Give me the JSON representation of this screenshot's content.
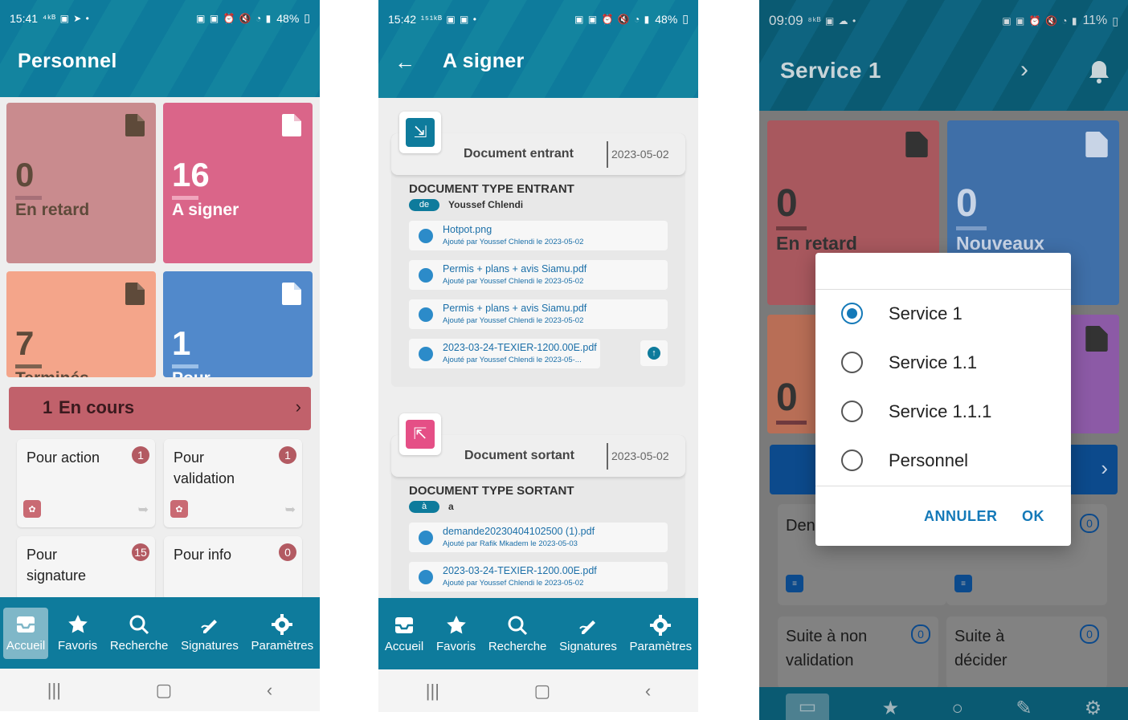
{
  "screen1": {
    "status": {
      "time": "15:41",
      "icons_left": "⁴ᵏᴮ ▣ ➤ •",
      "battery": "48%"
    },
    "title": "Personnel",
    "tiles": [
      {
        "count": "0",
        "label": "En retard",
        "color": "#c98b8e",
        "icon": "document-icon"
      },
      {
        "count": "16",
        "label": "A signer",
        "color": "#da6589",
        "icon": "document-icon"
      },
      {
        "count": "7",
        "label": "Terminés",
        "color": "#f4a58a",
        "icon": "document-icon"
      },
      {
        "count": "1",
        "label": "Pour",
        "color": "#5189cb",
        "icon": "document-icon"
      }
    ],
    "banner": {
      "count": "1",
      "label": "En cours",
      "color": "#c1616b"
    },
    "cards": [
      {
        "title": "Pour action",
        "badge": "1"
      },
      {
        "title": "Pour validation",
        "badge": "1"
      },
      {
        "title": "Pour signature",
        "badge": "15"
      },
      {
        "title": "Pour info",
        "badge": "0"
      }
    ],
    "nav": [
      {
        "label": "Accueil",
        "icon": "inbox-icon",
        "active": true
      },
      {
        "label": "Favoris",
        "icon": "star-icon"
      },
      {
        "label": "Recherche",
        "icon": "search-icon"
      },
      {
        "label": "Signatures",
        "icon": "signature-icon"
      },
      {
        "label": "Paramètres",
        "icon": "gear-icon"
      }
    ]
  },
  "screen2": {
    "status": {
      "time": "15:42",
      "icons_left": "¹⁵¹ᵏᴮ ▣ ▣ •",
      "battery": "48%"
    },
    "title": "A signer",
    "sections": [
      {
        "kind": "Document entrant",
        "date": "2023-05-02",
        "type_title": "DOCUMENT TYPE ENTRANT",
        "dir_tag": "de",
        "party": "Youssef Chlendi",
        "files": [
          {
            "name": "Hotpot.png",
            "sub": "Ajouté par Youssef Chlendi le 2023-05-02"
          },
          {
            "name": "Permis + plans + avis Siamu.pdf",
            "sub": "Ajouté par Youssef Chlendi le 2023-05-02"
          },
          {
            "name": "Permis + plans + avis Siamu.pdf",
            "sub": "Ajouté par Youssef Chlendi le 2023-05-02"
          },
          {
            "name": "2023-03-24-TEXIER-1200.00E.pdf",
            "sub": "Ajouté par Youssef Chlendi le 2023-05-..."
          }
        ]
      },
      {
        "kind": "Document sortant",
        "date": "2023-05-02",
        "type_title": "DOCUMENT TYPE SORTANT",
        "dir_tag": "à",
        "party": "a",
        "files": [
          {
            "name": "demande20230404102500 (1).pdf",
            "sub": "Ajouté par Rafik Mkadem le 2023-05-03"
          },
          {
            "name": "2023-03-24-TEXIER-1200.00E.pdf",
            "sub": "Ajouté par Youssef Chlendi le 2023-05-02"
          }
        ]
      }
    ],
    "nav": [
      {
        "label": "Accueil"
      },
      {
        "label": "Favoris"
      },
      {
        "label": "Recherche"
      },
      {
        "label": "Signatures"
      },
      {
        "label": "Paramètres"
      }
    ]
  },
  "screen3": {
    "status": {
      "time": "09:09",
      "icons_left": "⁸ᵏᴮ ▣ ☁ •",
      "battery": "11%"
    },
    "title": "Service 1",
    "tiles": [
      {
        "count": "0",
        "label": "En retard",
        "color": "#a8585e"
      },
      {
        "count": "0",
        "label": "Nouveaux",
        "color": "#3f6fa8"
      }
    ],
    "tile_partial": {
      "count": "0",
      "color_left": "#b86e56",
      "color_right": "#8c5aa6"
    },
    "cards": [
      {
        "title": "Den en cours",
        "badge": "0"
      },
      {
        "title": "",
        "badge": "0"
      },
      {
        "title": "Suite à non validation",
        "badge": "0"
      },
      {
        "title": "Suite à décider",
        "badge": "0"
      }
    ],
    "dialog": {
      "options": [
        {
          "label": "Service 1",
          "checked": true
        },
        {
          "label": "Service 1.1",
          "checked": false
        },
        {
          "label": "Service 1.1.1",
          "checked": false
        },
        {
          "label": "Personnel",
          "checked": false
        }
      ],
      "cancel": "ANNULER",
      "ok": "OK"
    }
  }
}
